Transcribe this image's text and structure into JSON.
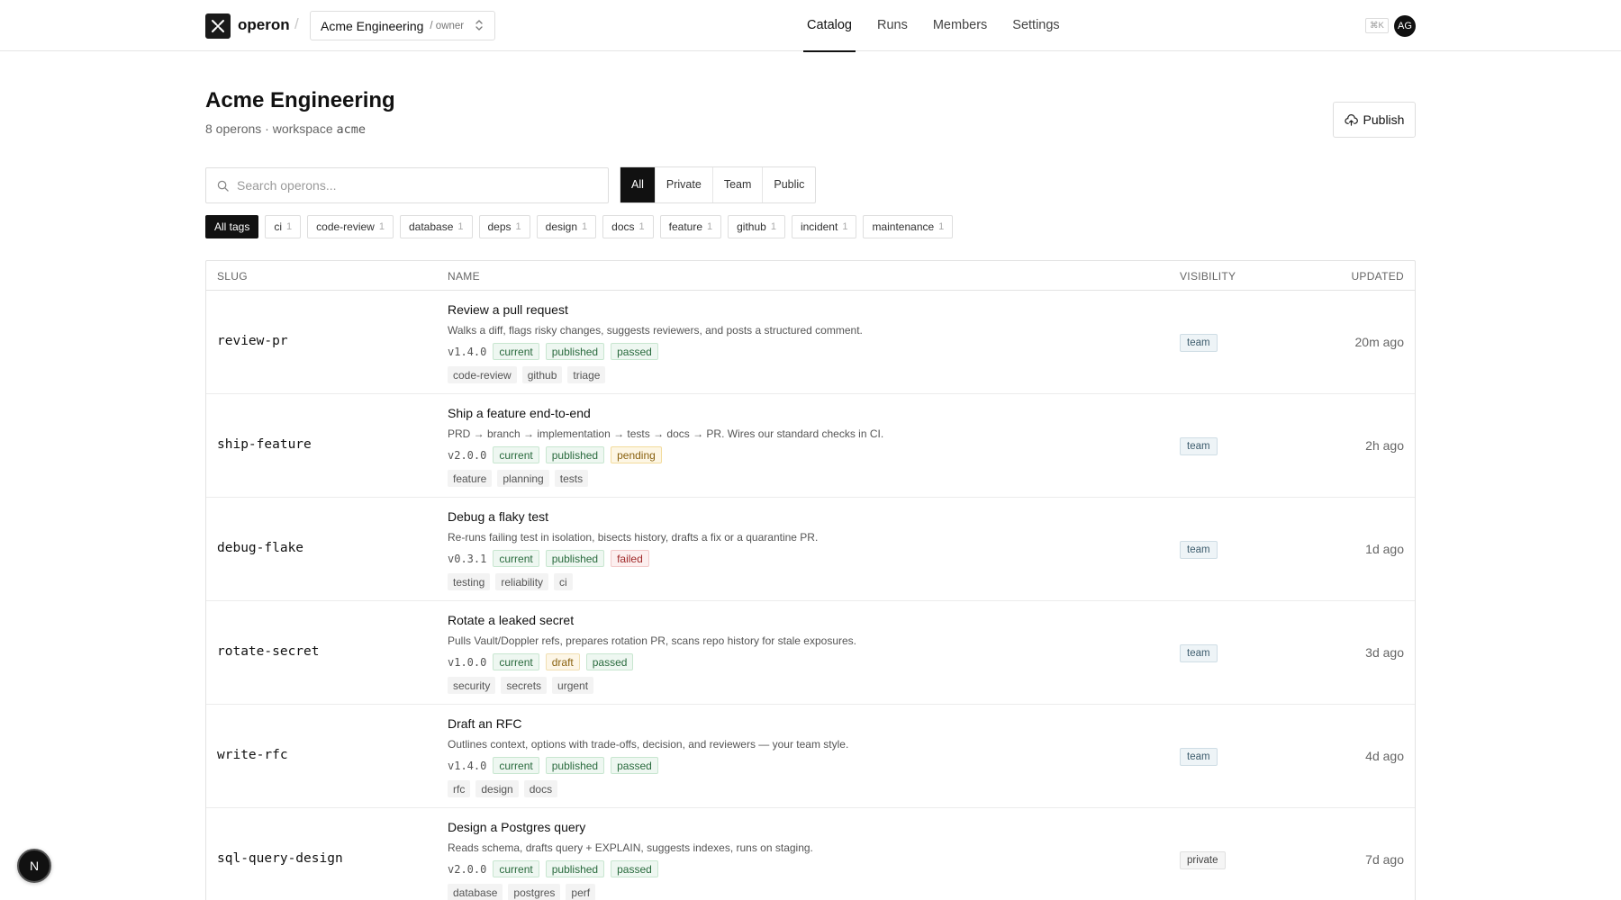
{
  "app": {
    "brand": "operon"
  },
  "workspace": {
    "name": "Acme Engineering",
    "role": "/ owner"
  },
  "nav": [
    {
      "label": "Catalog",
      "active": true
    },
    {
      "label": "Runs",
      "active": false
    },
    {
      "label": "Members",
      "active": false
    },
    {
      "label": "Settings",
      "active": false
    }
  ],
  "header": {
    "kbd": "⌘K",
    "avatar_initials": "AG",
    "title": "Acme Engineering",
    "subtitle_prefix": "8 operons · workspace ",
    "subtitle_slug": "acme",
    "publish_label": "Publish"
  },
  "search": {
    "placeholder": "Search operons..."
  },
  "visibility_filter": [
    {
      "label": "All",
      "active": true
    },
    {
      "label": "Private",
      "active": false
    },
    {
      "label": "Team",
      "active": false
    },
    {
      "label": "Public",
      "active": false
    }
  ],
  "tag_filter": [
    {
      "label": "All tags",
      "count": "",
      "active": true
    },
    {
      "label": "ci",
      "count": "1",
      "active": false
    },
    {
      "label": "code-review",
      "count": "1",
      "active": false
    },
    {
      "label": "database",
      "count": "1",
      "active": false
    },
    {
      "label": "deps",
      "count": "1",
      "active": false
    },
    {
      "label": "design",
      "count": "1",
      "active": false
    },
    {
      "label": "docs",
      "count": "1",
      "active": false
    },
    {
      "label": "feature",
      "count": "1",
      "active": false
    },
    {
      "label": "github",
      "count": "1",
      "active": false
    },
    {
      "label": "incident",
      "count": "1",
      "active": false
    },
    {
      "label": "maintenance",
      "count": "1",
      "active": false
    }
  ],
  "table": {
    "columns": {
      "slug": "SLUG",
      "name": "NAME",
      "visibility": "VISIBILITY",
      "updated": "UPDATED"
    },
    "rows": [
      {
        "slug": "review-pr",
        "name": "Review a pull request",
        "description": "Walks a diff, flags risky changes, suggests reviewers, and posts a structured comment.",
        "version": "v1.4.0",
        "badges": [
          {
            "label": "current",
            "kind": "current"
          },
          {
            "label": "published",
            "kind": "published"
          },
          {
            "label": "passed",
            "kind": "passed"
          }
        ],
        "tags": [
          "code-review",
          "github",
          "triage"
        ],
        "visibility": "team",
        "updated": "20m ago"
      },
      {
        "slug": "ship-feature",
        "name": "Ship a feature end-to-end",
        "description": "PRD → branch → implementation → tests → docs → PR. Wires our standard checks in CI.",
        "version": "v2.0.0",
        "badges": [
          {
            "label": "current",
            "kind": "current"
          },
          {
            "label": "published",
            "kind": "published"
          },
          {
            "label": "pending",
            "kind": "pending"
          }
        ],
        "tags": [
          "feature",
          "planning",
          "tests"
        ],
        "visibility": "team",
        "updated": "2h ago"
      },
      {
        "slug": "debug-flake",
        "name": "Debug a flaky test",
        "description": "Re-runs failing test in isolation, bisects history, drafts a fix or a quarantine PR.",
        "version": "v0.3.1",
        "badges": [
          {
            "label": "current",
            "kind": "current"
          },
          {
            "label": "published",
            "kind": "published"
          },
          {
            "label": "failed",
            "kind": "failed"
          }
        ],
        "tags": [
          "testing",
          "reliability",
          "ci"
        ],
        "visibility": "team",
        "updated": "1d ago"
      },
      {
        "slug": "rotate-secret",
        "name": "Rotate a leaked secret",
        "description": "Pulls Vault/Doppler refs, prepares rotation PR, scans repo history for stale exposures.",
        "version": "v1.0.0",
        "badges": [
          {
            "label": "current",
            "kind": "current"
          },
          {
            "label": "draft",
            "kind": "draft"
          },
          {
            "label": "passed",
            "kind": "passed"
          }
        ],
        "tags": [
          "security",
          "secrets",
          "urgent"
        ],
        "visibility": "team",
        "updated": "3d ago"
      },
      {
        "slug": "write-rfc",
        "name": "Draft an RFC",
        "description": "Outlines context, options with trade-offs, decision, and reviewers — your team style.",
        "version": "v1.4.0",
        "badges": [
          {
            "label": "current",
            "kind": "current"
          },
          {
            "label": "published",
            "kind": "published"
          },
          {
            "label": "passed",
            "kind": "passed"
          }
        ],
        "tags": [
          "rfc",
          "design",
          "docs"
        ],
        "visibility": "team",
        "updated": "4d ago"
      },
      {
        "slug": "sql-query-design",
        "name": "Design a Postgres query",
        "description": "Reads schema, drafts query + EXPLAIN, suggests indexes, runs on staging.",
        "version": "v2.0.0",
        "badges": [
          {
            "label": "current",
            "kind": "current"
          },
          {
            "label": "published",
            "kind": "published"
          },
          {
            "label": "passed",
            "kind": "passed"
          }
        ],
        "tags": [
          "database",
          "postgres",
          "perf"
        ],
        "visibility": "private",
        "updated": "7d ago"
      }
    ]
  },
  "fab": {
    "label": "N"
  }
}
